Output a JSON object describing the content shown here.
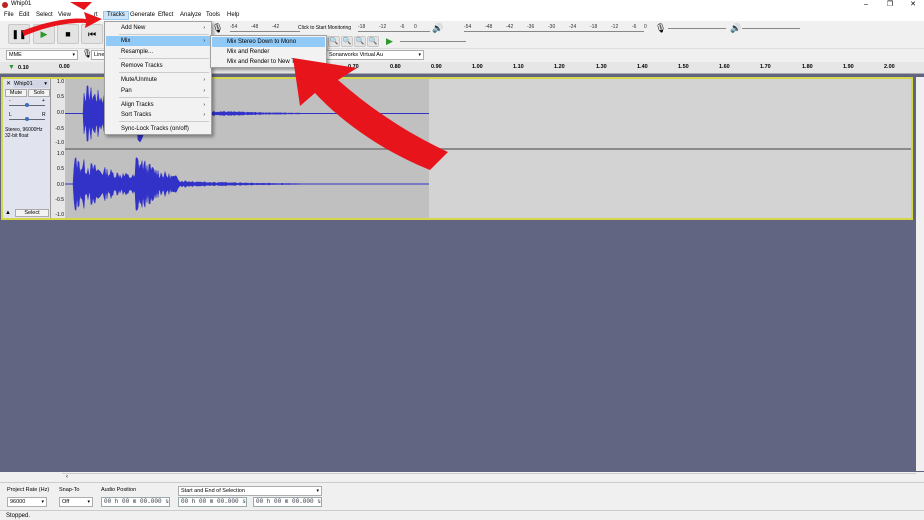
{
  "window": {
    "title": "Whip01",
    "minimize": "–",
    "restore": "❐",
    "close": "✕"
  },
  "menubar": [
    "File",
    "Edit",
    "Select",
    "View",
    "Transport",
    "Tracks",
    "Generate",
    "Effect",
    "Analyze",
    "Tools",
    "Help"
  ],
  "menubar_visible": {
    "file": "File",
    "edit": "Edit",
    "select": "Select",
    "view": "View",
    "transport_tail": "rt",
    "tracks": "Tracks",
    "generate": "Generate",
    "effect": "Effect",
    "analyze": "Analyze",
    "tools": "Tools",
    "help": "Help"
  },
  "tracks_menu": {
    "add_new": "Add New",
    "mix": "Mix",
    "resample": "Resample...",
    "remove_tracks": "Remove Tracks",
    "mute_unmute": "Mute/Unmute",
    "pan": "Pan",
    "align_tracks": "Align Tracks",
    "sort_tracks": "Sort Tracks",
    "sync_lock": "Sync-Lock Tracks (on/off)",
    "submenu_arrow": "›"
  },
  "mix_submenu": {
    "mix_stereo_down": "Mix Stereo Down to Mono",
    "mix_and_render": "Mix and Render",
    "mix_render_new": "Mix and Render to New Tra"
  },
  "toolbar": {
    "pause": "❚❚",
    "play": "▶",
    "stop": "■",
    "skip_start": "⏮",
    "rec_meter_hint": "Click to Start Monitoring",
    "rec_meter_ticks": [
      "-54",
      "-48",
      "-42"
    ],
    "rec_meter_ticks2": [
      "-18",
      "-12",
      "-6",
      "0"
    ],
    "play_meter_ticks": [
      "-54",
      "-48",
      "-42",
      "-36",
      "-30",
      "-24",
      "-18",
      "-12",
      "-6",
      "0"
    ],
    "lr": "L R"
  },
  "device": {
    "host": "MME",
    "input": "Line",
    "output": "Sonarworks Virtual Au"
  },
  "ruler": {
    "timeshift_value": "0.10",
    "start_label": "0.00",
    "ticks": [
      "0.70",
      "0.80",
      "0.90",
      "1.00",
      "1.10",
      "1.20",
      "1.30",
      "1.40",
      "1.50",
      "1.60",
      "1.70",
      "1.80",
      "1.90",
      "2.00"
    ]
  },
  "track": {
    "name": "Whip01",
    "mute": "Mute",
    "solo": "Solo",
    "gain_min": "-",
    "gain_max": "+",
    "pan_left": "L",
    "pan_right": "R",
    "info_line1": "Stereo, 96000Hz",
    "info_line2": "32-bit float",
    "select": "Select",
    "vruler_top": [
      "1.0",
      "0.5",
      "0.0",
      "-0.5",
      "-1.0"
    ],
    "vruler_bottom": [
      "1.0",
      "0.5",
      "0.0",
      "-0.5",
      "-1.0"
    ]
  },
  "bottom": {
    "project_rate_label": "Project Rate (Hz)",
    "project_rate_value": "96000",
    "snap_to_label": "Snap-To",
    "snap_to_value": "Off",
    "audio_position_label": "Audio Position",
    "audio_position_value": "00 h 00 m 00.000 s",
    "selection_label": "Start and End of Selection",
    "selection_start": "00 h 00 m 00.000 s",
    "selection_end": "00 h 00 m 00.000 s"
  },
  "status": "Stopped.",
  "colors": {
    "waveform": "#3232c8",
    "annotation_arrow": "#e8141b",
    "highlight": "#91c9f7",
    "track_bg": "#616582"
  }
}
